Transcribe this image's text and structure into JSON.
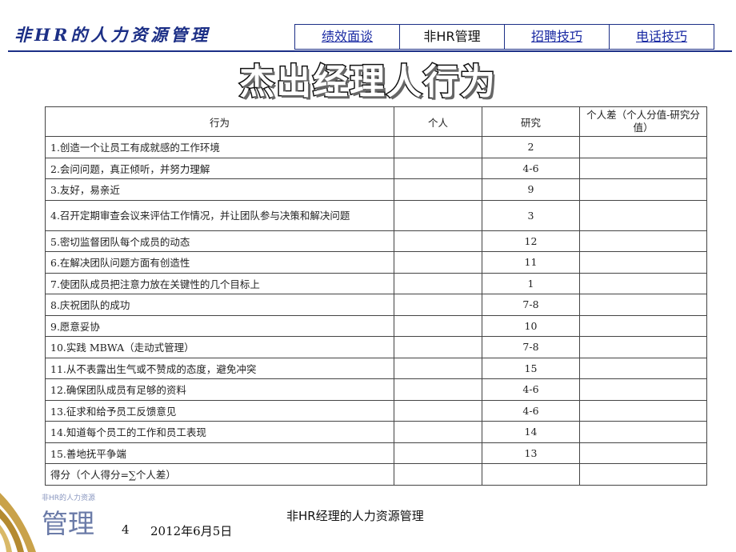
{
  "header": {
    "brand": "非HR的人力资源管理",
    "tabs": [
      {
        "label": "绩效面谈",
        "active": false
      },
      {
        "label": "非HR管理",
        "active": true
      },
      {
        "label": "招聘技巧",
        "active": false
      },
      {
        "label": "电话技巧",
        "active": false
      }
    ]
  },
  "page_title": "杰出经理人行为",
  "table": {
    "headers": {
      "behavior": "行为",
      "individual": "个人",
      "research": "研究",
      "difference": "个人差（个人分值-研究分值）"
    },
    "rows": [
      {
        "behavior": "1.创造一个让员工有成就感的工作环境",
        "research": "2"
      },
      {
        "behavior": "2.会问问题，真正倾听，并努力理解",
        "research": "4-6"
      },
      {
        "behavior": "3.友好，易亲近",
        "research": "9"
      },
      {
        "behavior": "4.召开定期审查会议来评估工作情况，并让团队参与决策和解决问题",
        "research": "3"
      },
      {
        "behavior": "5.密切监督团队每个成员的动态",
        "research": "12"
      },
      {
        "behavior": "6.在解决团队问题方面有创造性",
        "research": "11"
      },
      {
        "behavior": "7.使团队成员把注意力放在关键性的几个目标上",
        "research": "1"
      },
      {
        "behavior": "8.庆祝团队的成功",
        "research": "7-8"
      },
      {
        "behavior": "9.愿意妥协",
        "research": "10"
      },
      {
        "behavior": "10.实践 MBWA（走动式管理）",
        "research": "7-8"
      },
      {
        "behavior": "11.从不表露出生气或不赞成的态度，避免冲突",
        "research": "15"
      },
      {
        "behavior": "12.确保团队成员有足够的资料",
        "research": "4-6"
      },
      {
        "behavior": "13.征求和给予员工反馈意见",
        "research": "4-6"
      },
      {
        "behavior": "14.知道每个员工的工作和员工表现",
        "research": "14"
      },
      {
        "behavior": "15.善地抚平争端",
        "research": "13"
      }
    ],
    "total_label": "得分（个人得分=∑个人差）"
  },
  "footer": {
    "logo_small": "非HR的人力资源",
    "logo_text": "管理",
    "page_number": "4",
    "date": "2012年6月5日",
    "center_text": "非HR经理的人力资源管理"
  }
}
